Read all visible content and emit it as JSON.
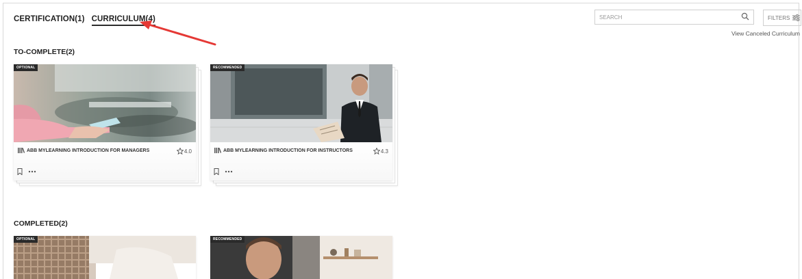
{
  "tabs": [
    {
      "label": "CERTIFICATION(1)",
      "active": false
    },
    {
      "label": "CURRICULUM(4)",
      "active": true
    }
  ],
  "search": {
    "placeholder": "SEARCH",
    "icon": "search-icon"
  },
  "filters": {
    "label": "FILTERS",
    "icon": "sliders-icon"
  },
  "canceled_link": "View Canceled Curriculum",
  "sections": {
    "to_complete": {
      "title": "TO-COMPLETE(2)",
      "cards": [
        {
          "badge": "OPTIONAL",
          "title": "ABB MYLEARNING INTRODUCTION FOR MANAGERS",
          "rating": "4.0"
        },
        {
          "badge": "RECOMMENDED",
          "title": "ABB MYLEARNING INTRODUCTION FOR INSTRUCTORS",
          "rating": "4.3"
        }
      ]
    },
    "completed": {
      "title": "COMPLETED(2)",
      "cards": [
        {
          "badge": "OPTIONAL"
        },
        {
          "badge": "RECOMMENDED"
        }
      ]
    }
  },
  "colors": {
    "arrow": "#e53935",
    "badge_bg": "#2a2a2a",
    "tab_underline": "#2b2b2b"
  }
}
